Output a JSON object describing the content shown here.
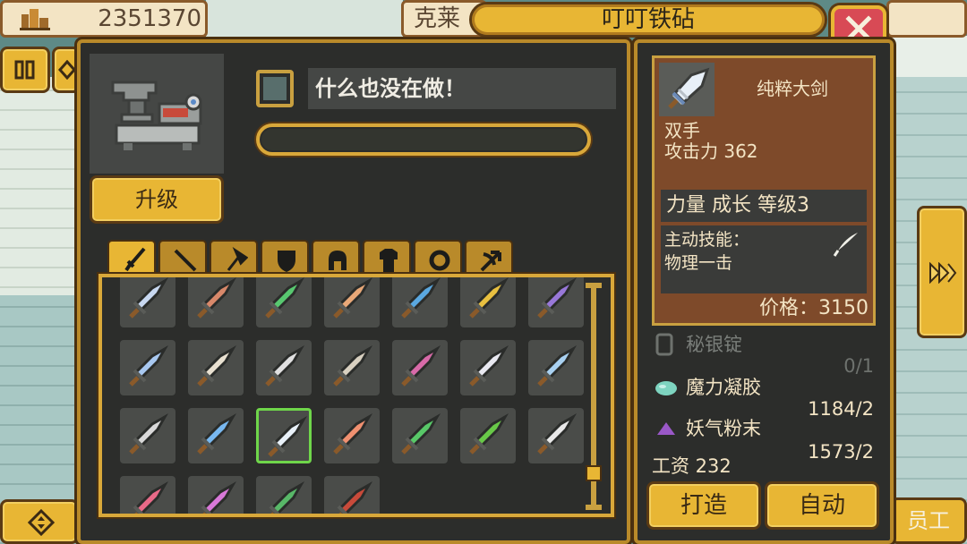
{
  "topbar": {
    "coins": "2351370",
    "npc_name": "克莱",
    "shop_title": "叮叮铁砧",
    "staff_label": "员工"
  },
  "forge": {
    "upgrade_label": "升级",
    "status_text": "什么也没在做！",
    "progress": 0
  },
  "tabs": [
    {
      "name": "sword",
      "icon": "sword-icon",
      "active": true
    },
    {
      "name": "spear",
      "icon": "spear-icon",
      "active": false
    },
    {
      "name": "axe",
      "icon": "axe-icon",
      "active": false
    },
    {
      "name": "shield",
      "icon": "shield-icon",
      "active": false
    },
    {
      "name": "helmet",
      "icon": "helmet-icon",
      "active": false
    },
    {
      "name": "armor",
      "icon": "armor-icon",
      "active": false
    },
    {
      "name": "ring",
      "icon": "ring-icon",
      "active": false
    },
    {
      "name": "bow",
      "icon": "bow-icon",
      "active": false
    }
  ],
  "grid": {
    "rows": [
      [
        "#c8d8f0",
        "#d8886a",
        "#58c870",
        "#e8a878",
        "#5aa8e0",
        "#e8c040",
        "#9878d8"
      ],
      [
        "#a8c8f0",
        "#e8e0d0",
        "#e0e0e0",
        "#d8d0c0",
        "#d86aa8",
        "#e8e8f0",
        "#a8d0f0"
      ],
      [
        "#d8d8d8",
        "#78b8f0",
        "#e8f0f8",
        "#f09070",
        "#58c868",
        "#68c848",
        "#e8e8e8"
      ],
      [
        "#e86a88",
        "#d878d8",
        "#58b868",
        "#c84a3a"
      ]
    ],
    "selected_row": 2,
    "selected_col": 2
  },
  "item": {
    "name": "纯粹大剑",
    "hand": "双手",
    "attack": "攻击力 362",
    "growth": "力量 成长 等级3",
    "skill_title": "主动技能：",
    "skill_name": "物理一击",
    "price": "价格：3150"
  },
  "materials": [
    {
      "name": "秘银锭",
      "count": "0/1",
      "icon": "ingot-icon",
      "color": "#7a7e7a"
    },
    {
      "name": "魔力凝胶",
      "count": "1184/2",
      "icon": "gel-icon",
      "color": "#f3e4c4"
    },
    {
      "name": "妖气粉末",
      "count": "1573/2",
      "icon": "powder-icon",
      "color": "#f3e4c4"
    }
  ],
  "wage": "工资 232",
  "actions": {
    "forge_label": "打造",
    "auto_label": "自动"
  },
  "colors": {
    "gold": "#e8b634",
    "panel": "#2c2d2b",
    "card": "#7e4a2a",
    "close": "#d84a55",
    "selected": "#6fd64a"
  }
}
